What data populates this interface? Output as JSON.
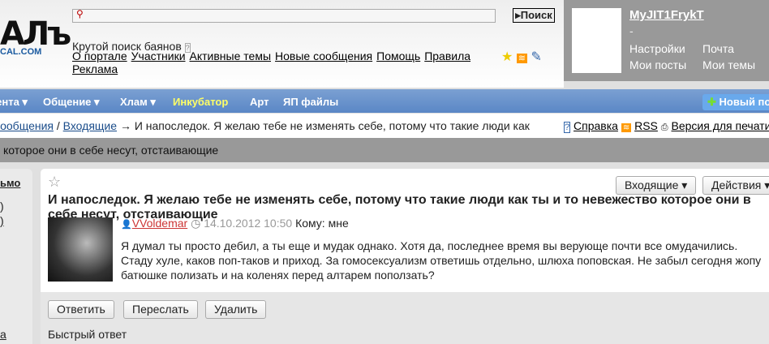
{
  "header": {
    "logo": "ХЛАМЪ",
    "logo_sub": "YAPLAKAL.COM",
    "search_placeholder": "",
    "search_button": "Поиск",
    "tagline": "Крутой поиск баянов",
    "links": [
      "О портале",
      "Участники",
      "Активные темы",
      "Новые сообщения",
      "Помощь",
      "Правила",
      "Реклама"
    ]
  },
  "user": {
    "name": "MyJIT1FrykT",
    "status": "-",
    "links": [
      "Настройки",
      "Почта",
      "Мои посты",
      "Мои темы"
    ]
  },
  "nav": {
    "items": [
      "Лента ▾",
      "Общение ▾",
      "Хлам ▾",
      "Инкубатор",
      "Арт",
      "ЯП файлы"
    ],
    "new_button": "Новый пост",
    "highlight": "#ffff66"
  },
  "breadcrumb": {
    "parent": "Сообщения",
    "current_link": "Входящие",
    "arrow": "→",
    "title": "И напоследок. Я желаю тебе не изменять себе, потому что такие люди как"
  },
  "toolbar": {
    "help": "Справка",
    "rss": "RSS",
    "print": "Версия для печати"
  },
  "greybar": {
    "text": "которое они в себе несут, отстаивающие"
  },
  "sidebar": {
    "items": [
      "ьмо",
      ")",
      ")",
      "а"
    ]
  },
  "message": {
    "folder_button": "Входящие ▾",
    "actions_button": "Действия ▾",
    "title": "И напоследок. Я желаю тебе не изменять себе, потому что такие люди как ты и то невежество которое они в себе несут, отстаивающие",
    "author": "VVoldemar",
    "date": "14.10.2012 10:50",
    "to": "Кому: мне",
    "body": "Я думал ты просто дебил, а ты еще и мудак однако. Хотя да, последнее время вы верующе почти все омудачились. Стаду хуле, каков поп-таков и приход. За гомосексуализм ответишь отдельно, шлюха поповская. Не забыл сегодня жопу батюшке полизать и на коленях перед алтарем поползать?"
  },
  "actions": {
    "reply": "Ответить",
    "forward": "Переслать",
    "delete": "Удалить",
    "quick_reply": "Быстрый ответ"
  }
}
